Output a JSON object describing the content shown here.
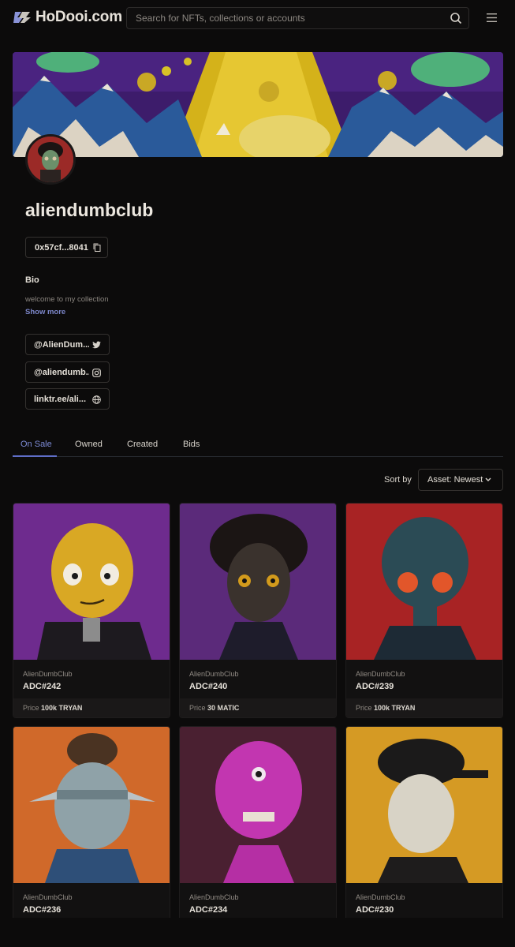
{
  "header": {
    "brand": "HoDooi.com",
    "search_placeholder": "Search for NFTs, collections or accounts"
  },
  "profile": {
    "username": "aliendumbclub",
    "address": "0x57cf...8041",
    "bio_title": "Bio",
    "bio_text": "welcome to my collection",
    "show_more": "Show more",
    "socials": [
      {
        "label": "@AlienDum...",
        "icon": "twitter-icon"
      },
      {
        "label": "@aliendumb...",
        "icon": "instagram-icon"
      },
      {
        "label": "linktr.ee/ali...",
        "icon": "globe-icon"
      }
    ]
  },
  "tabs": [
    "On Sale",
    "Owned",
    "Created",
    "Bids"
  ],
  "active_tab": "On Sale",
  "sort": {
    "label": "Sort by",
    "value": "Asset: Newest"
  },
  "cards": [
    {
      "collection": "AlienDumbClub",
      "name": "ADC#242",
      "price_label": "Price",
      "price": "100k TRYAN"
    },
    {
      "collection": "AlienDumbClub",
      "name": "ADC#240",
      "price_label": "Price",
      "price": "30 MATIC"
    },
    {
      "collection": "AlienDumbClub",
      "name": "ADC#239",
      "price_label": "Price",
      "price": "100k TRYAN"
    },
    {
      "collection": "AlienDumbClub",
      "name": "ADC#236"
    },
    {
      "collection": "AlienDumbClub",
      "name": "ADC#234"
    },
    {
      "collection": "AlienDumbClub",
      "name": "ADC#230"
    }
  ],
  "colors": {
    "background": "#0c0b0b",
    "accent": "#7d8bd6"
  }
}
